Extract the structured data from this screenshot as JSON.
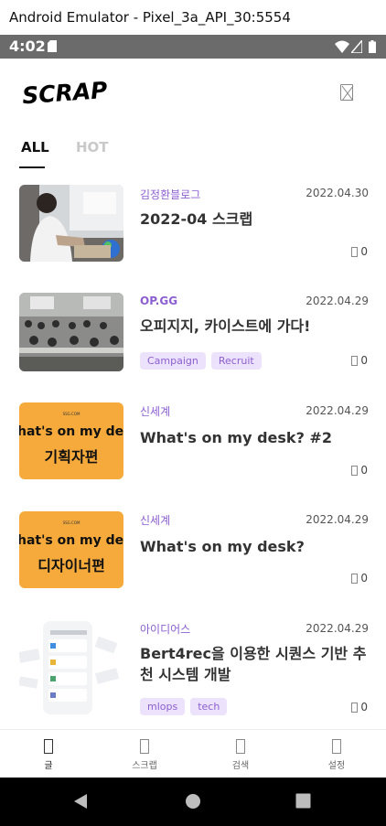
{
  "window": {
    "title": "Android Emulator - Pixel_3a_API_30:5554"
  },
  "status_bar": {
    "time": "4:02"
  },
  "app": {
    "logo": "SCRAP"
  },
  "tabs": [
    {
      "label": "ALL",
      "active": true
    },
    {
      "label": "HOT",
      "active": false
    }
  ],
  "posts": [
    {
      "source": "김정환블로그",
      "date": "2022.04.30",
      "title": "2022-04 스크랩",
      "tags": [],
      "likes": "0"
    },
    {
      "source": "OP.GG",
      "date": "2022.04.29",
      "title": "오피지지, 카이스트에 가다!",
      "tags": [
        "Campaign",
        "Recruit"
      ],
      "likes": "0"
    },
    {
      "source": "신세계",
      "date": "2022.04.29",
      "title": "What's on my desk? #2",
      "tags": [],
      "likes": "0",
      "thumb_line1": "hat's on my des",
      "thumb_line2": "기획자편"
    },
    {
      "source": "신세계",
      "date": "2022.04.29",
      "title": "What's on my desk?",
      "tags": [],
      "likes": "0",
      "thumb_line1": "hat's on my des",
      "thumb_line2": "디자이너편"
    },
    {
      "source": "아이디어스",
      "date": "2022.04.29",
      "title": "Bert4rec을 이용한 시퀀스 기반 추천 시스템 개발",
      "tags": [
        "mlops",
        "tech"
      ],
      "likes": "0"
    }
  ],
  "bottom_nav": [
    {
      "label": "글"
    },
    {
      "label": "스크랩"
    },
    {
      "label": "검색"
    },
    {
      "label": "설정"
    }
  ],
  "colors": {
    "accent": "#8c5fd1",
    "tag_bg": "#ece2fb",
    "thumb_orange": "#f6aa3c",
    "status_bar": "#6b6b6b"
  }
}
